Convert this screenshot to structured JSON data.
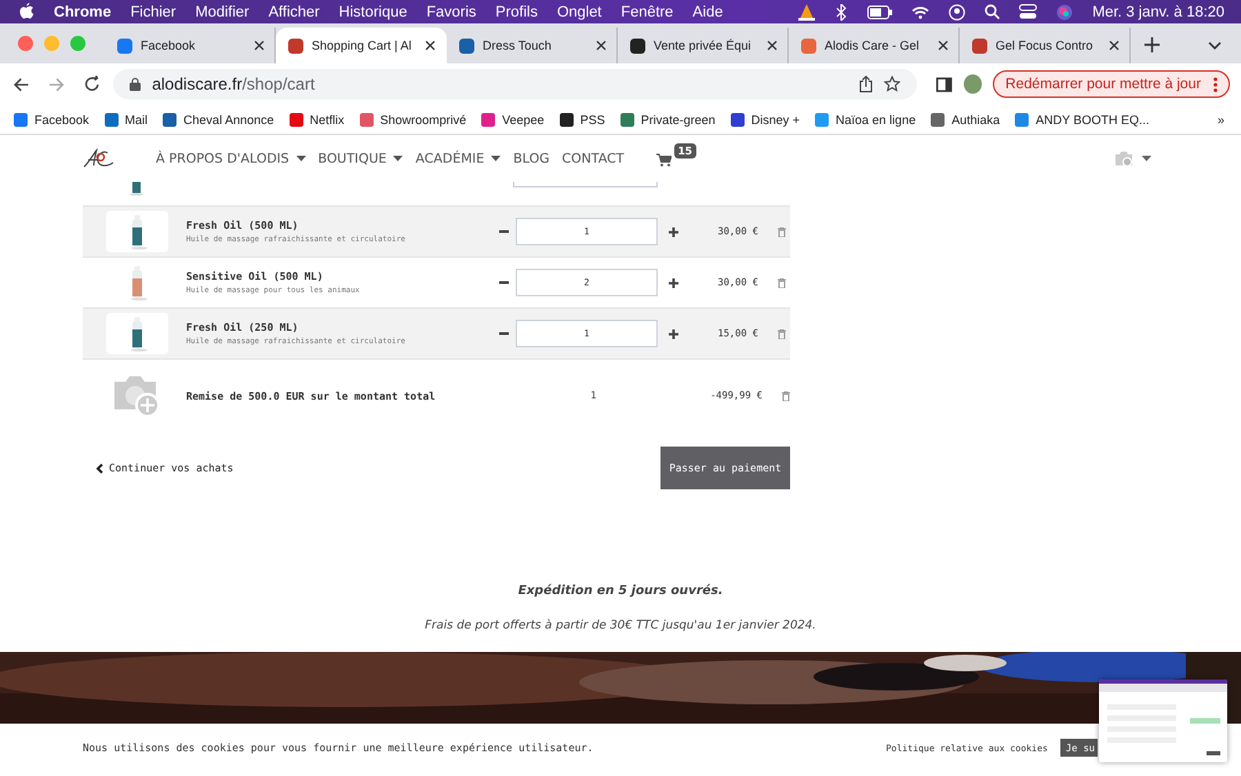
{
  "menubar": {
    "items": [
      "Chrome",
      "Fichier",
      "Modifier",
      "Afficher",
      "Historique",
      "Favoris",
      "Profils",
      "Onglet",
      "Fenêtre",
      "Aide"
    ],
    "clock": "Mer. 3 janv. à 18:20"
  },
  "tabs": [
    {
      "label": "Facebook",
      "selected": false,
      "color": "#1877f2"
    },
    {
      "label": "Shopping Cart | Al",
      "selected": true,
      "color": "#c0392b"
    },
    {
      "label": "Dress Touch",
      "selected": false,
      "color": "#1a5fa8"
    },
    {
      "label": "Vente privée Équi",
      "selected": false,
      "color": "#222222"
    },
    {
      "label": "Alodis Care - Gel",
      "selected": false,
      "color": "#e8663d"
    },
    {
      "label": "Gel Focus Contro",
      "selected": false,
      "color": "#c0392b"
    }
  ],
  "address": {
    "host": "alodiscare.fr",
    "path": "/shop/cart"
  },
  "update_button": "Redémarrer pour mettre à jour",
  "bookmarks": [
    {
      "label": "Facebook",
      "color": "#1877f2"
    },
    {
      "label": "Mail",
      "color": "#0f6cbd"
    },
    {
      "label": "Cheval Annonce",
      "color": "#1a5fa8"
    },
    {
      "label": "Netflix",
      "color": "#e50914"
    },
    {
      "label": "Showroomprivé",
      "color": "#e25563"
    },
    {
      "label": "Veepee",
      "color": "#e0218a"
    },
    {
      "label": "PSS",
      "color": "#222222"
    },
    {
      "label": "Private-green",
      "color": "#2e7d5b"
    },
    {
      "label": "Disney +",
      "color": "#2f3fd1"
    },
    {
      "label": "Naïoa en ligne",
      "color": "#1e9bf0"
    },
    {
      "label": "Authiaka",
      "color": "#666666"
    },
    {
      "label": "ANDY BOOTH EQ...",
      "color": "#1e88e5"
    }
  ],
  "bookmarks_more": "»",
  "nav": {
    "items": [
      {
        "label": "À PROPOS D'ALODIS",
        "dropdown": true
      },
      {
        "label": "BOUTIQUE",
        "dropdown": true
      },
      {
        "label": "ACADÉMIE",
        "dropdown": true
      },
      {
        "label": "BLOG",
        "dropdown": false
      },
      {
        "label": "CONTACT",
        "dropdown": false
      }
    ],
    "cart_count": "15"
  },
  "cart": {
    "rows": [
      {
        "kind": "product",
        "name": "Fresh Oil (500 ML)",
        "description": "Huile de massage rafraichissante et circulatoire",
        "quantity": "1",
        "price": "30,00 €",
        "color": "#2f6f7a"
      },
      {
        "kind": "product",
        "name": "Sensitive Oil (500 ML)",
        "description": "Huile de massage pour tous les animaux",
        "quantity": "2",
        "price": "30,00 €",
        "color": "#d98f72"
      },
      {
        "kind": "product",
        "name": "Fresh Oil (250 ML)",
        "description": "Huile de massage rafraichissante et circulatoire",
        "quantity": "1",
        "price": "15,00 €",
        "color": "#2f6f7a"
      },
      {
        "kind": "discount",
        "name": "Remise de 500.0 EUR sur le montant total",
        "quantity": "1",
        "price": "-499,99 €"
      }
    ]
  },
  "continue_link": "Continuer vos achats",
  "checkout_button": "Passer au paiement",
  "shipping": {
    "title": "Expédition en 5 jours ouvrés.",
    "note": "Frais de port offerts à partir de 30€ TTC jusqu'au 1er janvier 2024."
  },
  "cookie_bar": {
    "message": "Nous utilisons des cookies pour vous fournir une meilleure expérience utilisateur.",
    "policy_link": "Politique relative aux cookies",
    "accept_button": "Je su"
  }
}
